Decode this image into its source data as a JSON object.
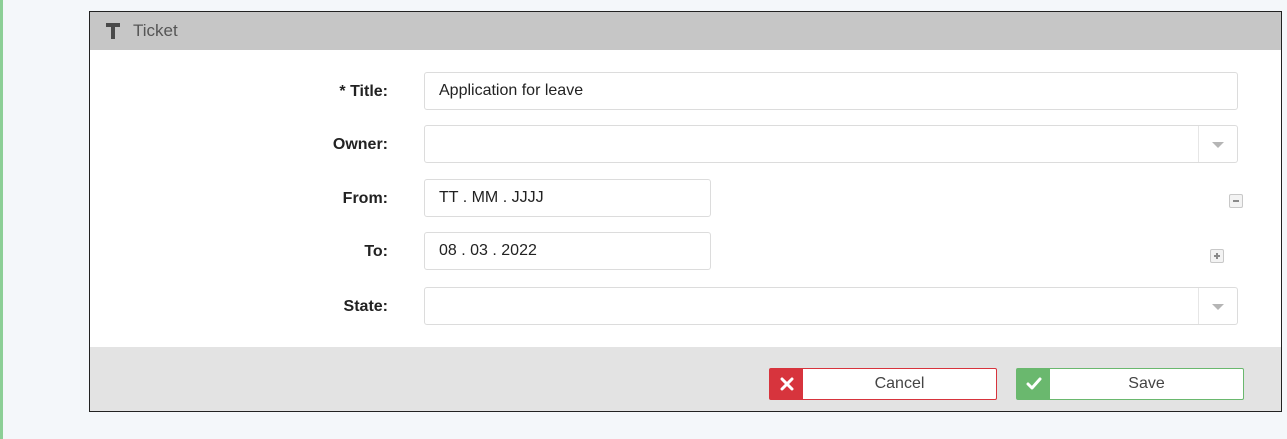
{
  "panel": {
    "title": "Ticket",
    "icon": "text-t-icon"
  },
  "form": {
    "title": {
      "label": "* Title:",
      "value": "Application for leave"
    },
    "owner": {
      "label": "Owner:",
      "value": ""
    },
    "from": {
      "label": "From:",
      "value": "TT . MM . JJJJ"
    },
    "to": {
      "label": "To:",
      "value": "08 . 03 . 2022"
    },
    "state": {
      "label": "State:",
      "value": ""
    }
  },
  "actions": {
    "cancel_label": "Cancel",
    "save_label": "Save"
  },
  "colors": {
    "cancel": "#d7343d",
    "save": "#6ab86e",
    "header": "#c6c6c6",
    "accent": "#8ccf96"
  }
}
